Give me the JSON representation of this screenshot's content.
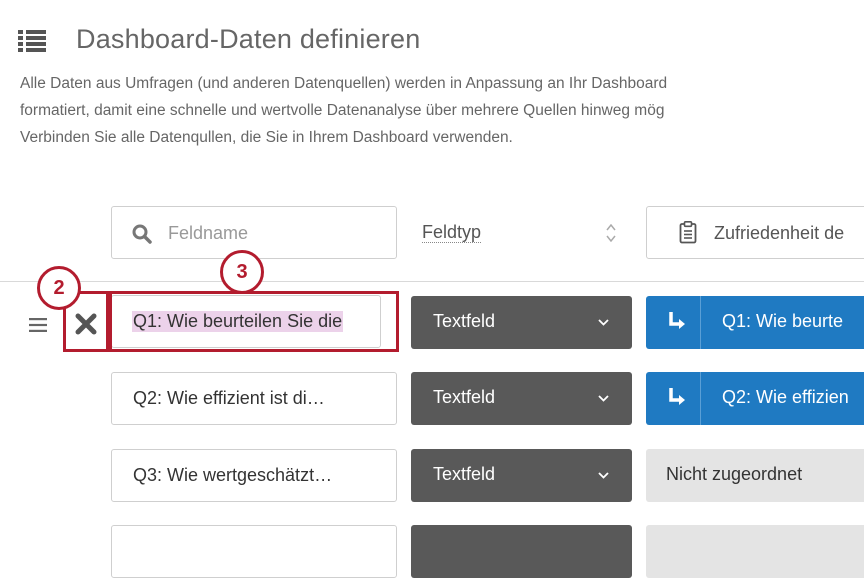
{
  "header": {
    "title": "Dashboard-Daten definieren",
    "icon": "list-icon",
    "description_lines": [
      "Alle Daten aus Umfragen (und anderen Datenquellen) werden in Anpassung an Ihr Dashboard",
      "formatiert, damit eine schnelle und wertvolle Datenanalyse über mehrere Quellen hinweg mög",
      "Verbinden Sie alle Datenqullen, die Sie in Ihrem Dashboard verwenden."
    ]
  },
  "columns": {
    "search_placeholder": "Feldname",
    "field_type_label": "Feldtyp",
    "source_label": "Zufriedenheit de"
  },
  "rows": [
    {
      "field_name": "Q1: Wie beurteilen Sie die",
      "field_type": "Textfeld",
      "mapping": "Q1: Wie beurte",
      "mapped": true
    },
    {
      "field_name": "Q2: Wie effizient ist di…",
      "field_type": "Textfeld",
      "mapping": "Q2: Wie effizien",
      "mapped": true
    },
    {
      "field_name": "Q3: Wie wertgeschätzt…",
      "field_type": "Textfeld",
      "mapping": "Nicht zugeordnet",
      "mapped": false
    }
  ],
  "callouts": {
    "badge_2": "2",
    "badge_3": "3",
    "color": "#b31c2e"
  },
  "colors": {
    "dropdown_bg": "#595959",
    "mapped_bg": "#1f7ac2",
    "unmapped_bg": "#e4e4e4",
    "highlight": "#ecd2ea"
  }
}
